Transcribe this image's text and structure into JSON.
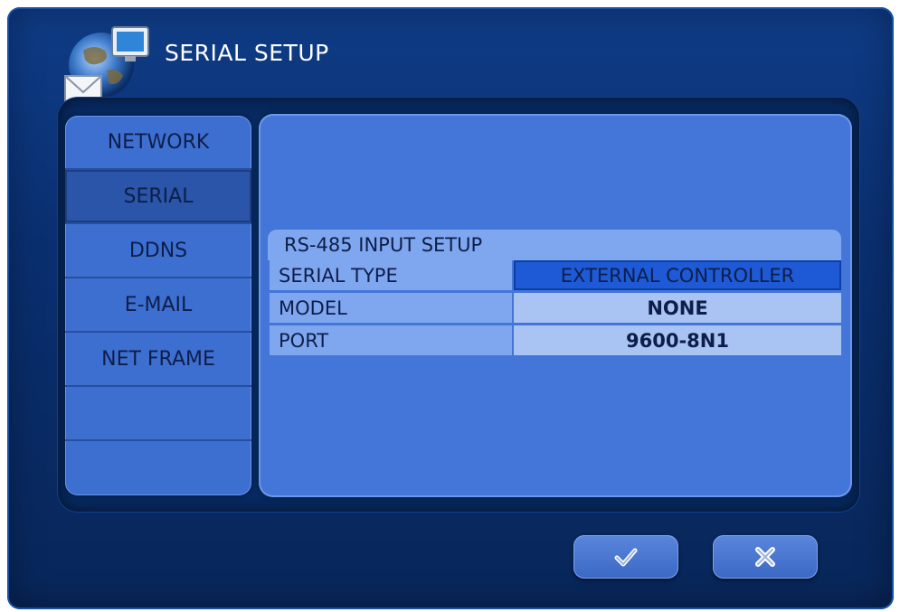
{
  "window": {
    "title": "SERIAL SETUP",
    "icon": "network-globe-mail-icon"
  },
  "sidebar": {
    "items": [
      {
        "label": "NETWORK",
        "active": false
      },
      {
        "label": "SERIAL",
        "active": true
      },
      {
        "label": "DDNS",
        "active": false
      },
      {
        "label": "E-MAIL",
        "active": false
      },
      {
        "label": "NET FRAME",
        "active": false
      },
      {
        "label": "",
        "active": false
      },
      {
        "label": "",
        "active": false
      }
    ]
  },
  "main": {
    "section_title": "RS-485 INPUT SETUP",
    "rows": [
      {
        "label": "SERIAL TYPE",
        "value": "EXTERNAL CONTROLLER",
        "selected": true
      },
      {
        "label": "MODEL",
        "value": "NONE",
        "selected": false
      },
      {
        "label": "PORT",
        "value": "9600-8N1",
        "selected": false
      }
    ]
  },
  "buttons": {
    "ok_icon": "checkmark-icon",
    "cancel_icon": "close-x-icon"
  },
  "colors": {
    "window_bg": "#0a2f70",
    "panel_bg": "#4376d8",
    "label_bg": "#7fa7ef",
    "value_bg": "#a9c4f3",
    "selected_bg": "#1e5ad6",
    "text": "#0e1e4a"
  }
}
